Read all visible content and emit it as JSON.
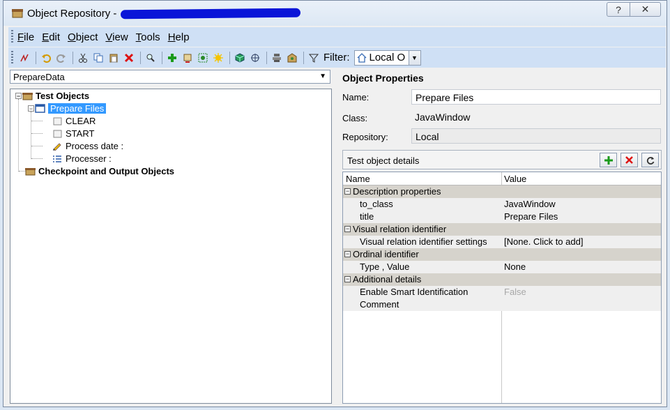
{
  "window": {
    "title": "Object Repository -",
    "help_glyph": "?",
    "close_glyph": "✕"
  },
  "menu": [
    {
      "accel": "F",
      "rest": "ile"
    },
    {
      "accel": "E",
      "rest": "dit"
    },
    {
      "accel": "O",
      "rest": "bject"
    },
    {
      "accel": "V",
      "rest": "iew"
    },
    {
      "accel": "T",
      "rest": "ools"
    },
    {
      "accel": "H",
      "rest": "elp"
    }
  ],
  "toolbar": {
    "filter_label": "Filter:",
    "filter_value": "Local O"
  },
  "repository_select": {
    "value": "PrepareData"
  },
  "tree": {
    "root": "Test Objects",
    "window_node": "Prepare Files",
    "children": [
      "CLEAR",
      "START",
      "Process date :",
      "Processer :"
    ],
    "checkpoints": "Checkpoint and Output Objects"
  },
  "properties": {
    "heading": "Object Properties",
    "name_label": "Name:",
    "name_value": "Prepare Files",
    "class_label": "Class:",
    "class_value": "JavaWindow",
    "repository_label": "Repository:",
    "repository_value": "Local"
  },
  "details": {
    "heading": "Test object details",
    "col_name": "Name",
    "col_value": "Value",
    "rows": [
      {
        "kind": "section",
        "name": "Description properties",
        "value": ""
      },
      {
        "kind": "item",
        "name": "to_class",
        "value": "JavaWindow"
      },
      {
        "kind": "item",
        "name": "title",
        "value": "Prepare Files"
      },
      {
        "kind": "section",
        "name": "Visual relation identifier",
        "value": ""
      },
      {
        "kind": "item",
        "name": "Visual relation identifier settings",
        "value": "[None. Click to add]"
      },
      {
        "kind": "section",
        "name": "Ordinal identifier",
        "value": ""
      },
      {
        "kind": "item",
        "name": "Type , Value",
        "value": "None"
      },
      {
        "kind": "section",
        "name": "Additional details",
        "value": ""
      },
      {
        "kind": "item",
        "name": "Enable Smart Identification",
        "value": "False",
        "disabled": true
      },
      {
        "kind": "item",
        "name": "Comment",
        "value": ""
      }
    ]
  },
  "colors": {
    "selection": "#3399ff",
    "toolbar_bg": "#cfe0f5",
    "section_bg": "#d6d3cc",
    "redaction": "#0a15d8"
  }
}
